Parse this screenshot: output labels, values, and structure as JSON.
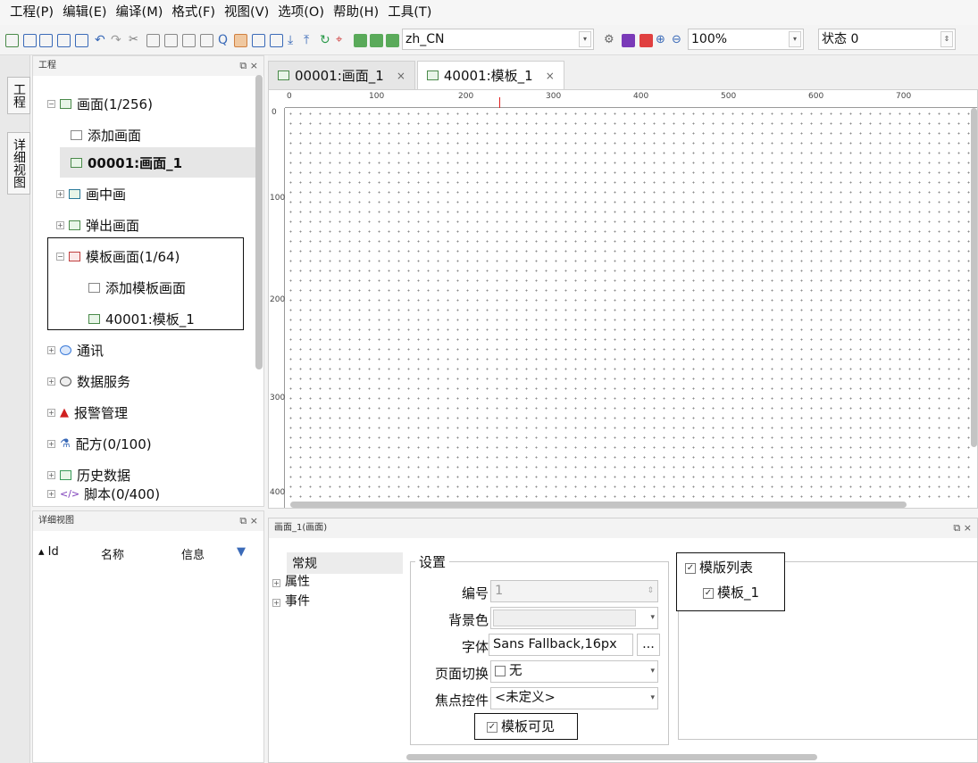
{
  "menu": [
    "工程(P)",
    "编辑(E)",
    "编译(M)",
    "格式(F)",
    "视图(V)",
    "选项(O)",
    "帮助(H)",
    "工具(T)"
  ],
  "toolbar": {
    "language": "zh_CN",
    "zoom": "100%",
    "state": "状态 0"
  },
  "vtabs": [
    "工程",
    "详细视图"
  ],
  "project_panel": {
    "title": "工程",
    "tree": [
      {
        "label": "画面(1/256)",
        "bold": false
      },
      {
        "label": "添加画面",
        "bold": false
      },
      {
        "label": "00001:画面_1",
        "bold": true
      },
      {
        "label": "画中画",
        "bold": false
      },
      {
        "label": "弹出画面",
        "bold": false
      },
      {
        "label": "模板画面(1/64)",
        "bold": false
      },
      {
        "label": "添加模板画面",
        "bold": false
      },
      {
        "label": "40001:模板_1",
        "bold": false
      },
      {
        "label": "通讯",
        "bold": false
      },
      {
        "label": "数据服务",
        "bold": false
      },
      {
        "label": "报警管理",
        "bold": false
      },
      {
        "label": "配方(0/100)",
        "bold": false
      },
      {
        "label": "历史数据",
        "bold": false
      },
      {
        "label": "脚本(0/400)",
        "bold": false
      }
    ]
  },
  "detail_panel": {
    "title": "详细视图",
    "cols": [
      "Id",
      "名称",
      "信息"
    ]
  },
  "editor_tabs": [
    {
      "label": "00001:画面_1",
      "close": "×"
    },
    {
      "label": "40001:模板_1",
      "close": "×"
    }
  ],
  "ruler": {
    "h": [
      "0",
      "100",
      "200",
      "300",
      "400",
      "500",
      "600",
      "700"
    ],
    "v": [
      "0",
      "100",
      "200",
      "300",
      "400"
    ]
  },
  "props": {
    "title": "画面_1(画面)",
    "categories": [
      "常规",
      "属性",
      "事件"
    ],
    "group_title": "设置",
    "labels": {
      "id": "编号",
      "bg": "背景色",
      "font": "字体",
      "page_switch": "页面切换",
      "focus": "焦点控件"
    },
    "values": {
      "id": "1",
      "font": "Sans Fallback,16px",
      "font_btn": "...",
      "page_switch": "无",
      "focus": "<未定义>",
      "template_visible": "模板可见"
    },
    "template_list": {
      "title": "模版列表",
      "items": [
        "模板_1"
      ]
    }
  }
}
